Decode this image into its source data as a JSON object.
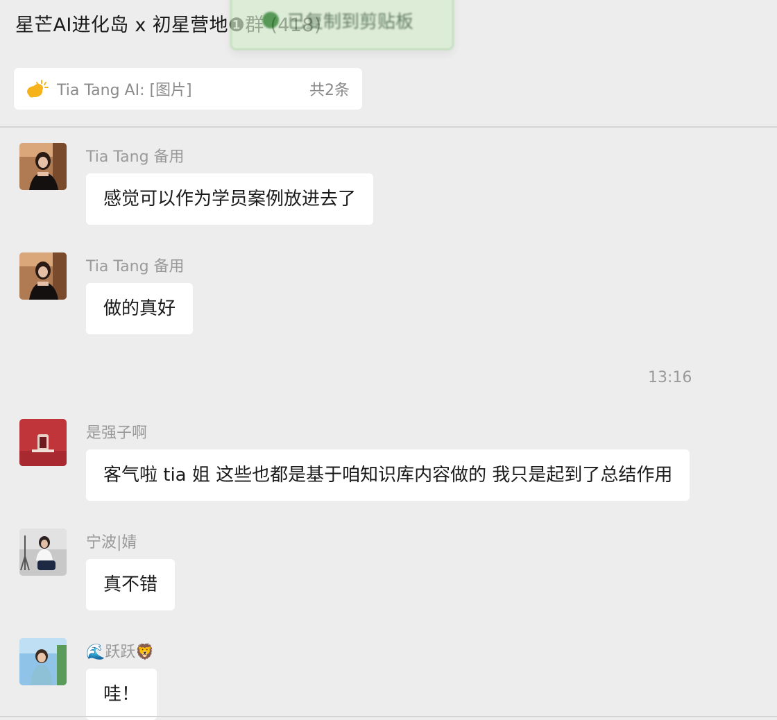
{
  "window": {
    "title": "星芒AI进化岛 x 初星营地❶群 (418)"
  },
  "toast": {
    "text": "已复制到剪贴板",
    "icon": "check-circle-icon"
  },
  "pinned": {
    "icon": "pinned-sun-cloud-icon",
    "text": "Tia Tang AI: [图片]",
    "count": "共2条"
  },
  "messages": [
    {
      "sender": "Tia Tang 备用",
      "text": "感觉可以作为学员案例放进去了",
      "avatar": "avatar-tia-tang"
    },
    {
      "sender": "Tia Tang 备用",
      "text": "做的真好",
      "avatar": "avatar-tia-tang"
    },
    {
      "sender": "是强子啊",
      "text": "客气啦 tia 姐 这些也都是基于咱知识库内容做的 我只是起到了总结作用",
      "avatar": "avatar-qiangzi"
    },
    {
      "sender": "宁波|婧",
      "text": "真不错",
      "avatar": "avatar-ningbo-jing"
    },
    {
      "sender": "🌊跃跃🦁",
      "text": "哇！",
      "avatar": "avatar-yueyue"
    }
  ],
  "timestamp": "13:16",
  "colors": {
    "background": "#ededed",
    "bubble": "#ffffff",
    "sender_text": "#9a9a9a",
    "pinned_icon": "#f5b21b"
  }
}
